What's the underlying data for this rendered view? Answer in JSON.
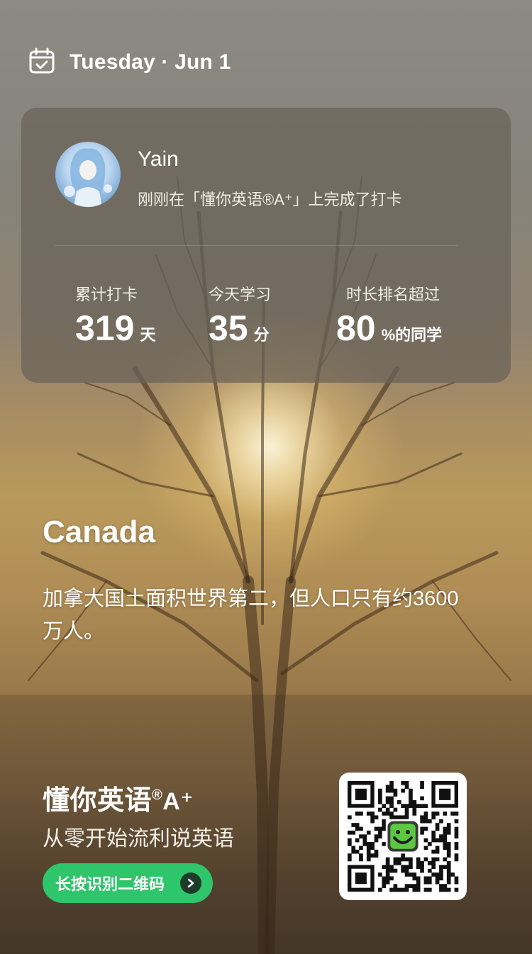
{
  "header": {
    "date_text": "Tuesday · Jun 1",
    "calendar_icon": "calendar-check-icon"
  },
  "card": {
    "user_name": "Yain",
    "status_text": "刚刚在「懂你英语®A⁺」上完成了打卡",
    "stats": [
      {
        "label": "累计打卡",
        "value": "319",
        "unit": "天"
      },
      {
        "label": "今天学习",
        "value": "35",
        "unit": "分"
      },
      {
        "label": "时长排名超过",
        "value": "80",
        "unit": "%的同学"
      }
    ]
  },
  "content": {
    "headline": "Canada",
    "fact": "加拿大国土面积世界第二，但人口只有约3600万人。"
  },
  "footer": {
    "brand_prefix": "懂你英语",
    "brand_reg": "®",
    "brand_suffix": "A⁺",
    "slogan": "从零开始流利说英语",
    "cta_label": "长按识别二维码",
    "cta_icon": "chevron-right-icon",
    "qr_icon": "qr-code-icon"
  },
  "colors": {
    "accent_green": "#2fc56b",
    "card_bg": "rgba(105,98,88,0.72)"
  }
}
